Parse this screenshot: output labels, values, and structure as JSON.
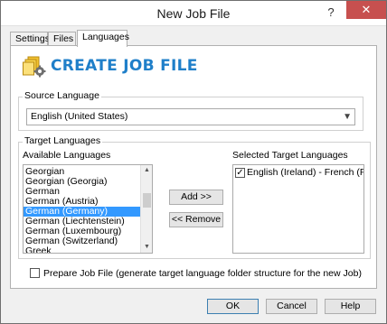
{
  "window": {
    "title": "New Job File",
    "help_glyph": "?",
    "close_glyph": "✕"
  },
  "tabs": [
    {
      "label": "Settings"
    },
    {
      "label": "Files"
    },
    {
      "label": "Languages"
    }
  ],
  "header": {
    "title": "CREATE JOB FILE",
    "icon": "job-file-gear-icon"
  },
  "source_language": {
    "group_label": "Source Language",
    "selected": "English (United States)"
  },
  "target_languages": {
    "group_label": "Target Languages",
    "available_label": "Available Languages",
    "available_items": [
      "Georgian",
      "Georgian (Georgia)",
      "German",
      "German (Austria)",
      "German (Germany)",
      "German (Liechtenstein)",
      "German (Luxembourg)",
      "German (Switzerland)",
      "Greek"
    ],
    "available_selected": "German (Germany)",
    "selected_label": "Selected Target Languages",
    "selected_items": [
      {
        "label": "English (Ireland) - French (France)",
        "checked": true
      }
    ],
    "add_button": "Add >>",
    "remove_button": "<< Remove"
  },
  "prepare": {
    "label": "Prepare Job File (generate target language folder structure for the new Job)",
    "checked": false
  },
  "footer": {
    "ok": "OK",
    "cancel": "Cancel",
    "help": "Help"
  },
  "colors": {
    "accent": "#1f7fc9",
    "selection": "#3399ff",
    "close": "#c7504f"
  }
}
